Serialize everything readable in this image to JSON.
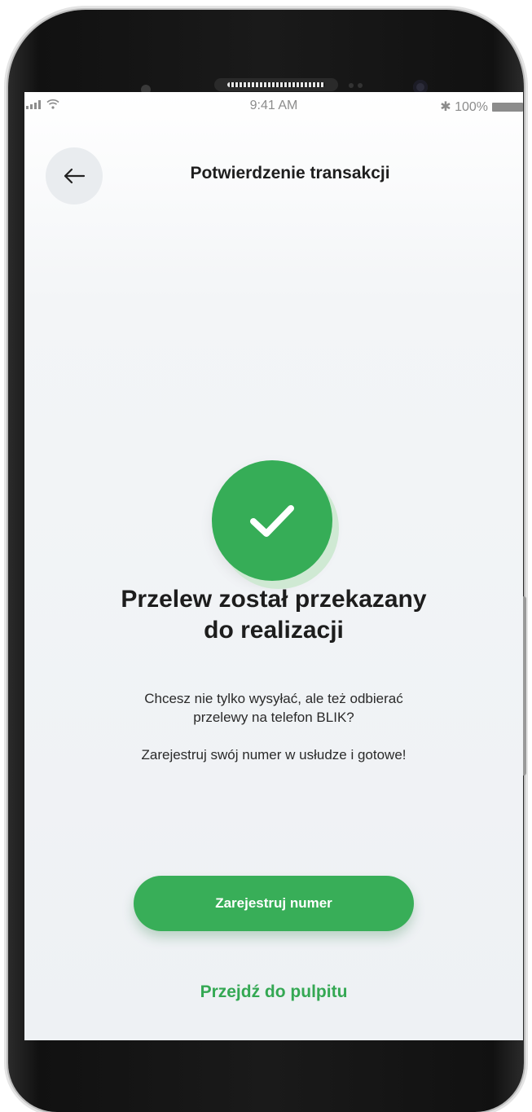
{
  "status_bar": {
    "time": "9:41 AM",
    "battery": "✱ 100%"
  },
  "header": {
    "title": "Potwierdzenie transakcji"
  },
  "content": {
    "heading_line1": "Przelew został przekazany",
    "heading_line2": "do realizacji",
    "paragraph1_line1": "Chcesz nie tylko wysyłać, ale też odbierać",
    "paragraph1_line2": "przelewy na telefon BLIK?",
    "paragraph2": "Zarejestruj swój numer w usłudze i gotowe!"
  },
  "actions": {
    "primary_label": "Zarejestruj numer",
    "secondary_label": "Przejdź do pulpitu"
  },
  "icons": {
    "back": "arrow-left-icon",
    "success": "checkmark-icon",
    "signal": "signal-icon",
    "wifi": "wifi-icon",
    "bluetooth": "bluetooth-icon",
    "battery": "battery-icon"
  },
  "colors": {
    "accent": "#36ad57",
    "accent_light": "#cfe9d3",
    "link": "#34a853",
    "text": "#1d1d1d"
  }
}
